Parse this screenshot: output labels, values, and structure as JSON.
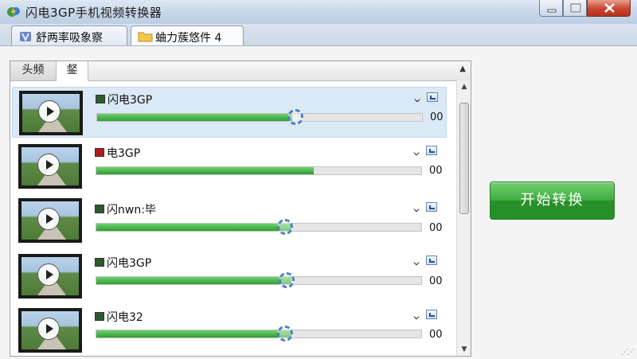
{
  "window": {
    "title": "闪电3GP手机视频转换器"
  },
  "outer_tabs": [
    {
      "label": "舒两率吸象察",
      "active": false
    },
    {
      "label": "蛐力蔟悠件 4",
      "active": true
    }
  ],
  "inner_tabs": [
    {
      "label": "头频",
      "active": false
    },
    {
      "label": "錖",
      "active": true
    }
  ],
  "files": [
    {
      "name": "闪电3GP",
      "progress_percent": 60,
      "percent_label": "00",
      "selected": true,
      "icon": "film-green-icon"
    },
    {
      "name": "电3GP",
      "progress_percent": 67,
      "percent_label": "00",
      "selected": false,
      "icon": "film-red-icon"
    },
    {
      "name": "闪nwn:毕",
      "progress_percent": 60,
      "percent_label": "00",
      "selected": false,
      "icon": "film-green-icon"
    },
    {
      "name": "闪电3GP",
      "progress_percent": 60,
      "percent_label": "00",
      "selected": false,
      "icon": "film-green-icon"
    },
    {
      "name": "闪电32",
      "progress_percent": 60,
      "percent_label": "00",
      "selected": false,
      "icon": "film-green-icon"
    }
  ],
  "start_button": {
    "label": "开始转换"
  },
  "colors": {
    "progress_fill": "#3aad3a",
    "start_button": "#37a637",
    "selection": "#dbe9f7",
    "spinner": "#4d82c5"
  }
}
